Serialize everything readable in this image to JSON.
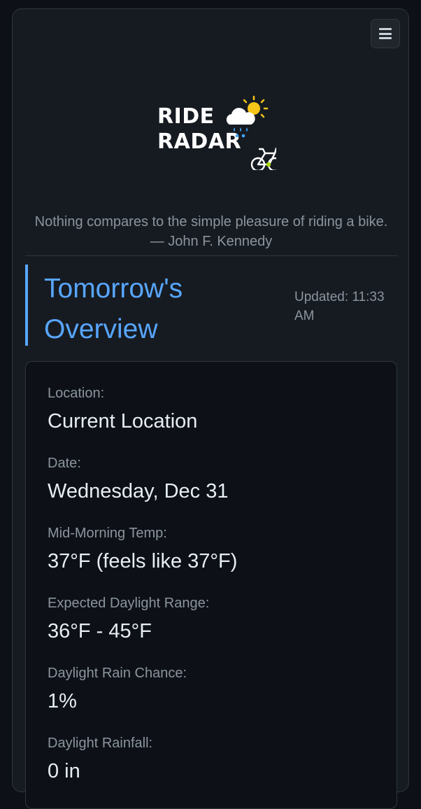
{
  "header": {
    "menu_icon": "hamburger-menu-icon",
    "logo": {
      "line1": "RIDE",
      "line2": "RADAR",
      "icons": [
        "cloud-rain-icon",
        "sun-icon",
        "bicycle-icon"
      ],
      "colors": {
        "sun": "#f5c518",
        "rain": "#3ea6ff",
        "bike": "#ffffff",
        "hub": "#a6d608"
      }
    },
    "quote": "Nothing compares to the simple pleasure of riding a bike. — John F. Kennedy"
  },
  "overview": {
    "title": "Tomorrow's Overview",
    "updated": "Updated: 11:33 AM",
    "fields": [
      {
        "label": "Location:",
        "value": "Current Location"
      },
      {
        "label": "Date:",
        "value": "Wednesday, Dec 31"
      },
      {
        "label": "Mid-Morning Temp:",
        "value": "37°F (feels like 37°F)"
      },
      {
        "label": "Expected Daylight Range:",
        "value": "36°F - 45°F"
      },
      {
        "label": "Daylight Rain Chance:",
        "value": "1%"
      },
      {
        "label": "Daylight Rainfall:",
        "value": "0 in"
      }
    ]
  },
  "theme": {
    "accent": "#58a6ff",
    "background": "#0d1117",
    "card": "#161b22",
    "border": "#30363d"
  }
}
